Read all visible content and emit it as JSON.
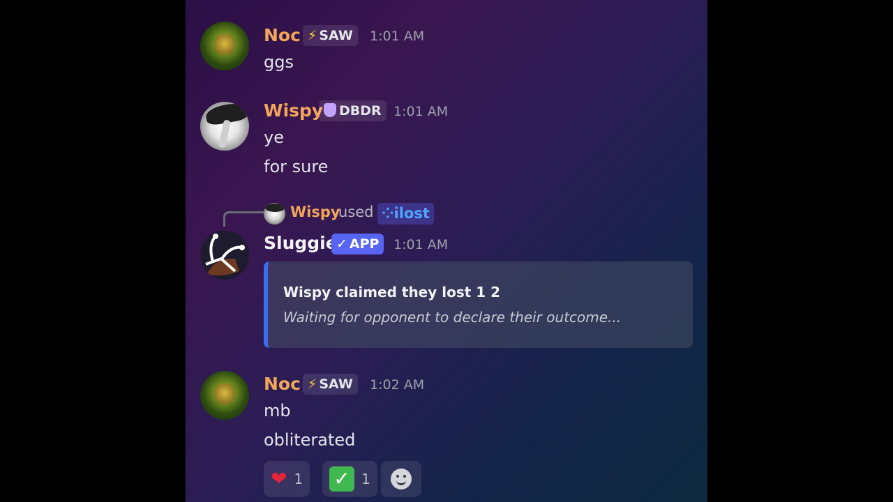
{
  "messages": [
    {
      "author": "Noc",
      "tag": {
        "icon": "⚡",
        "label": "SAW"
      },
      "time": "1:01 AM",
      "lines": [
        "ggs"
      ]
    },
    {
      "author": "Wispy",
      "tag": {
        "icon": "shield",
        "label": "DBDR"
      },
      "time": "1:01 AM",
      "lines": [
        "ye",
        "for sure"
      ]
    },
    {
      "reply": {
        "user": "Wispy",
        "used": "used",
        "command": "ilost",
        "command_icon": "⁘"
      },
      "author": "Sluggie",
      "tag": {
        "icon": "✓",
        "label": "APP"
      },
      "time": "1:01 AM",
      "embed": {
        "title": "Wispy claimed they lost 1 2",
        "description": "Waiting for opponent to declare their outcome..."
      }
    },
    {
      "author": "Noc",
      "tag": {
        "icon": "⚡",
        "label": "SAW"
      },
      "time": "1:02 AM",
      "lines": [
        "mb",
        "obliterated"
      ],
      "reactions": [
        {
          "emoji": "❤",
          "count": "1"
        },
        {
          "emoji": "✓",
          "count": "1"
        }
      ]
    }
  ],
  "colors": {
    "author_orange": "#f2a65a",
    "app_blue": "#5865f2",
    "embed_accent": "#3a6df0"
  }
}
